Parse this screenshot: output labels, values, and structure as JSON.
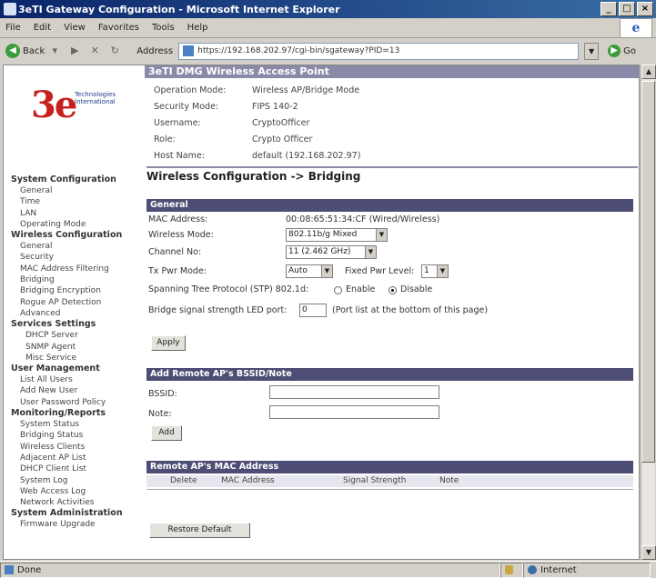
{
  "window": {
    "title": "3eTI Gateway Configuration - Microsoft Internet Explorer",
    "minimize": "_",
    "maximize": "□",
    "close": "×"
  },
  "menu": [
    "File",
    "Edit",
    "View",
    "Favorites",
    "Tools",
    "Help"
  ],
  "toolbar": {
    "back": "Back",
    "address_label": "Address",
    "url": "https://192.168.202.97/cgi-bin/sgateway?PID=13",
    "go": "Go"
  },
  "logo": {
    "mark": "3e",
    "tagline_1": "Technologies",
    "tagline_2": "International"
  },
  "sidebar": {
    "sections": [
      {
        "title": "System Configuration",
        "items": [
          "General",
          "Time",
          "LAN",
          "Operating Mode"
        ]
      },
      {
        "title": "Wireless Configuration",
        "items": [
          "General",
          "Security",
          "MAC Address Filtering",
          "Bridging",
          "Bridging Encryption",
          "Rogue AP Detection",
          "Advanced"
        ]
      },
      {
        "title": "Services Settings",
        "items": [
          "DHCP Server",
          "SNMP Agent",
          "Misc Service"
        ]
      },
      {
        "title": "User Management",
        "items": [
          "List All Users",
          "Add New User",
          "User Password Policy"
        ]
      },
      {
        "title": "Monitoring/Reports",
        "items": [
          "System Status",
          "Bridging Status",
          "Wireless Clients",
          "Adjacent AP List",
          "DHCP Client List",
          "System Log",
          "Web Access Log",
          "Network Activities"
        ]
      },
      {
        "title": "System Administration",
        "items": [
          "Firmware Upgrade"
        ]
      }
    ]
  },
  "device": {
    "header": "3eTI DMG Wireless Access Point",
    "rows": [
      {
        "label": "Operation Mode:",
        "value": "Wireless AP/Bridge Mode"
      },
      {
        "label": "Security Mode:",
        "value": "FIPS 140-2"
      },
      {
        "label": "Username:",
        "value": "CryptoOfficer"
      },
      {
        "label": "Role:",
        "value": "Crypto Officer"
      },
      {
        "label": "Host Name:",
        "value": "default (192.168.202.97)"
      }
    ]
  },
  "page_title": "Wireless Configuration -> Bridging",
  "general": {
    "header": "General",
    "mac_label": "MAC Address:",
    "mac_value": "00:08:65:51:34:CF (Wired/Wireless)",
    "wireless_mode_label": "Wireless Mode:",
    "wireless_mode_value": "802.11b/g Mixed",
    "channel_label": "Channel No:",
    "channel_value": "11 (2.462 GHz)",
    "txpwr_label": "Tx Pwr Mode:",
    "txpwr_value": "Auto",
    "fixed_pwr_label": "Fixed Pwr Level:",
    "fixed_pwr_value": "1",
    "stp_label": "Spanning Tree Protocol (STP) 802.1d:",
    "stp_enable": "Enable",
    "stp_disable": "Disable",
    "stp_selected": "Disable",
    "led_label": "Bridge signal strength LED port:",
    "led_value": "0",
    "led_hint": "(Port list at the bottom of this page)",
    "apply": "Apply"
  },
  "add_remote": {
    "header": "Add Remote AP's BSSID/Note",
    "bssid_label": "BSSID:",
    "bssid_value": "",
    "note_label": "Note:",
    "note_value": "",
    "add": "Add"
  },
  "remote_list": {
    "header": "Remote AP's MAC Address",
    "columns": [
      "Delete",
      "MAC Address",
      "Signal Strength",
      "Note"
    ]
  },
  "restore_default": "Restore Default",
  "status": {
    "left": "Done",
    "zone": "Internet"
  }
}
